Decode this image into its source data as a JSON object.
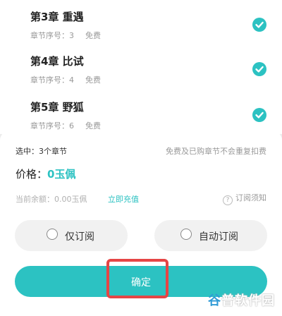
{
  "chapters": [
    {
      "title": "第3章 重遇",
      "meta": "章节序号：3",
      "price": "免费",
      "checked": true
    },
    {
      "title": "第4章 比试",
      "meta": "章节序号：4",
      "price": "免费",
      "checked": true
    },
    {
      "title": "第5章 野狐",
      "meta": "章节序号：6",
      "price": "免费",
      "checked": true
    }
  ],
  "summary": {
    "selected": "选中：3个章节",
    "note": "免费及已购章节不会重复扣费",
    "price_label": "价格：",
    "price_value": "0玉佩",
    "balance": "当前余额：0.00玉佩",
    "recharge": "立即充值",
    "notice": "订阅须知"
  },
  "options": {
    "once": "仅订阅",
    "auto": "自动订阅"
  },
  "confirm": "确定",
  "watermark": "谷普软件园",
  "colors": {
    "accent": "#2cc2c2",
    "highlight": "#e54545"
  }
}
